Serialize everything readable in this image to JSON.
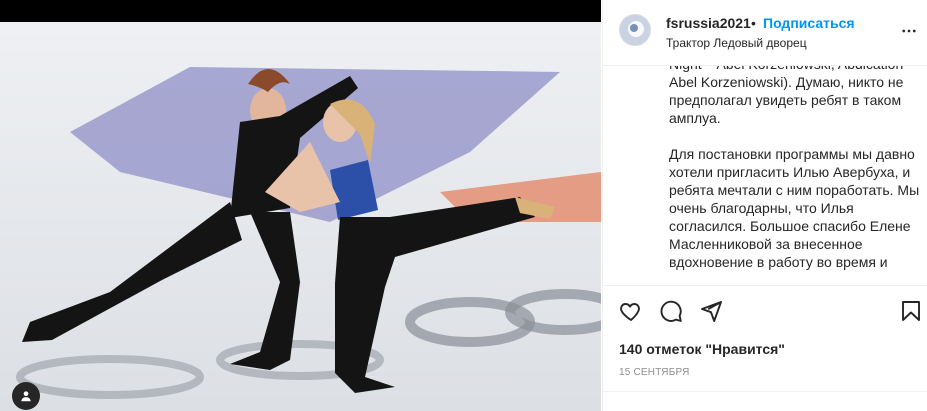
{
  "post": {
    "author": {
      "username": "fsrussia2021",
      "separator": "•",
      "follow_label": "Подписаться",
      "location": "Трактор Ледовый дворец"
    },
    "caption_lines": [
      "Night – Abel Korzeniowski, Abdication -",
      "Abel Korzeniowski). Думаю, никто не",
      "предполагал увидеть ребят в таком",
      "амплуа.",
      "",
      "Для постановки программы мы давно",
      "хотели пригласить Илью Авербуха, и",
      "ребята мечтали с ним поработать. Мы",
      "очень благодарны, что Илья",
      "согласился. Большое спасибо Елене",
      "Масленниковой за внесенное",
      "вдохновение в работу во время и"
    ],
    "likes_text": "140 отметок \"Нравится\"",
    "date": "15 СЕНТЯБРЯ"
  },
  "icons": {
    "more": "more-horizontal-icon",
    "like": "heart-icon",
    "comment": "comment-icon",
    "share": "paper-plane-icon",
    "save": "bookmark-icon",
    "tag": "user-tag-icon"
  },
  "colors": {
    "link_blue": "#0095f6",
    "text": "#262626",
    "muted": "#8e8e8e",
    "border": "#efefef"
  }
}
